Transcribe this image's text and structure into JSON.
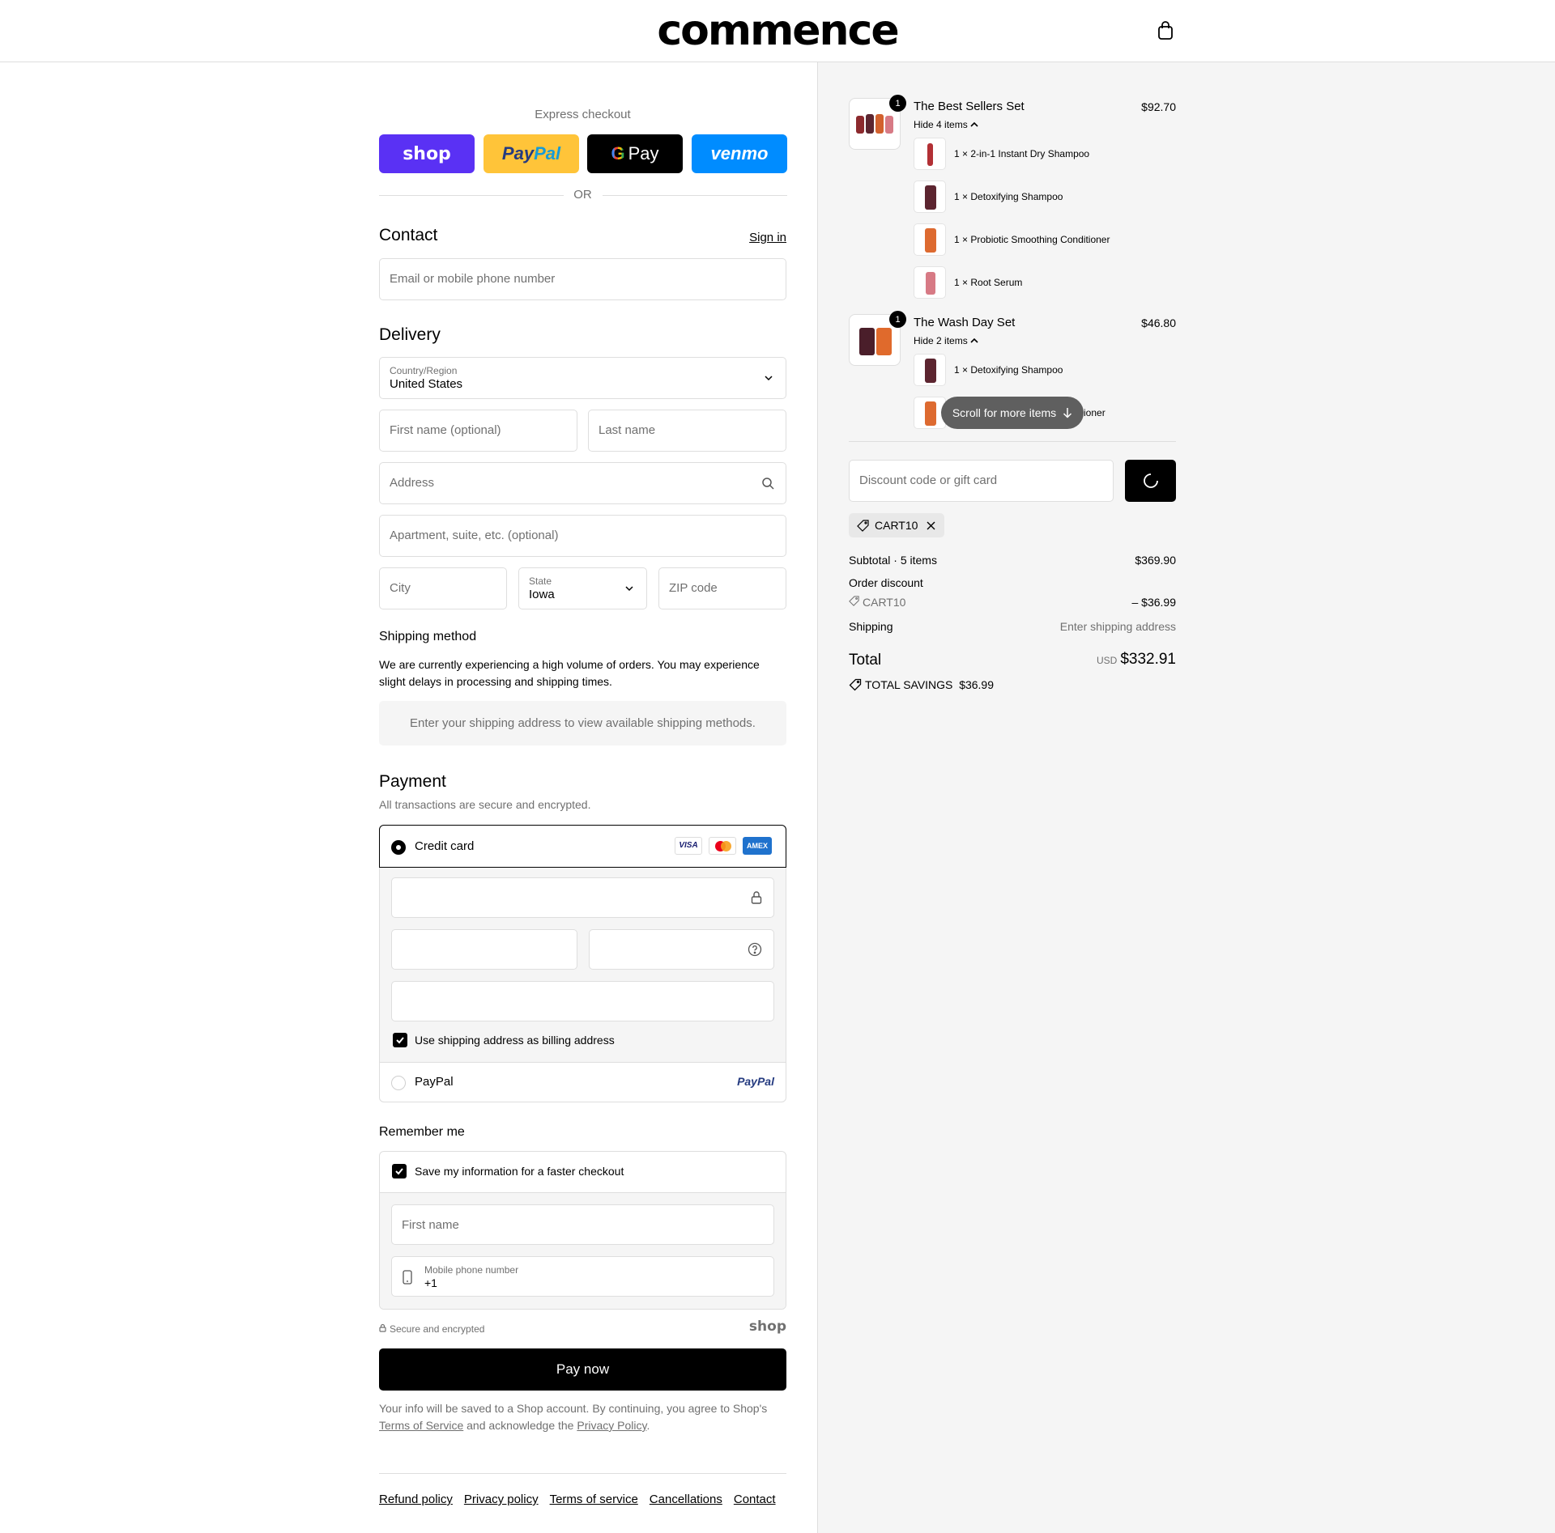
{
  "header": {
    "logo": "commence",
    "cart_icon": "bag-icon"
  },
  "express": {
    "title": "Express checkout",
    "buttons": {
      "shop": "shop",
      "paypal": "PayPal",
      "gpay": "Pay",
      "venmo": "venmo"
    },
    "or": "OR"
  },
  "contact": {
    "title": "Contact",
    "sign_in": "Sign in",
    "email_placeholder": "Email or mobile phone number"
  },
  "delivery": {
    "title": "Delivery",
    "country_label": "Country/Region",
    "country_value": "United States",
    "first_name_placeholder": "First name (optional)",
    "last_name_placeholder": "Last name",
    "address_placeholder": "Address",
    "apartment_placeholder": "Apartment, suite, etc. (optional)",
    "city_placeholder": "City",
    "state_label": "State",
    "state_value": "Iowa",
    "zip_placeholder": "ZIP code"
  },
  "shipping": {
    "title": "Shipping method",
    "notice": "We are currently experiencing a high volume of orders. You may experience slight delays in processing and shipping times.",
    "empty": "Enter your shipping address to view available shipping methods."
  },
  "payment": {
    "title": "Payment",
    "subtitle": "All transactions are secure and encrypted.",
    "credit_card": "Credit card",
    "cards": [
      "VISA",
      "Mastercard",
      "AMEX"
    ],
    "billing_checkbox": "Use shipping address as billing address",
    "paypal": "PayPal",
    "paypal_logo": "PayPal"
  },
  "remember": {
    "title": "Remember me",
    "save_checkbox": "Save my information for a faster checkout",
    "first_name_placeholder": "First name",
    "phone_label": "Mobile phone number",
    "phone_value": "+1",
    "secure": "Secure and encrypted",
    "shop_logo": "shop"
  },
  "pay_now": "Pay now",
  "legal": {
    "text_before": "Your info will be saved to a Shop account. By continuing, you agree to Shop's",
    "tos": "Terms of Service",
    "middle": "and acknowledge the",
    "privacy": "Privacy Policy",
    "end": "."
  },
  "footer_links": [
    "Refund policy",
    "Privacy policy",
    "Terms of service",
    "Cancellations",
    "Contact"
  ],
  "order": {
    "items": [
      {
        "qty": "1",
        "name": "The Best Sellers Set",
        "price": "$92.70",
        "toggle": "Hide 4 items",
        "sub": [
          {
            "qty": "1 ×",
            "name": "2-in-1 Instant Dry Shampoo"
          },
          {
            "qty": "1 ×",
            "name": "Detoxifying Shampoo"
          },
          {
            "qty": "1 ×",
            "name": "Probiotic Smoothing Conditioner"
          },
          {
            "qty": "1 ×",
            "name": "Root Serum"
          }
        ]
      },
      {
        "qty": "1",
        "name": "The Wash Day Set",
        "price": "$46.80",
        "toggle": "Hide 2 items",
        "sub": [
          {
            "qty": "1 ×",
            "name": "Detoxifying Shampoo"
          },
          {
            "qty": "",
            "name": "ioner"
          }
        ]
      }
    ],
    "scroll_pill": "Scroll for more items",
    "discount_placeholder": "Discount code or gift card",
    "applied_code": "CART10",
    "subtotal_label": "Subtotal · 5 items",
    "subtotal_value": "$369.90",
    "order_discount_label": "Order discount",
    "discount_code": "CART10",
    "discount_value": "– $36.99",
    "shipping_label": "Shipping",
    "shipping_value": "Enter shipping address",
    "total_label": "Total",
    "currency": "USD",
    "total_value": "$332.91",
    "savings_label": "TOTAL SAVINGS",
    "savings_value": "$36.99"
  },
  "colors": {
    "shop": "#5a31f4",
    "paypal": "#ffc439",
    "venmo": "#008cff",
    "text_muted": "#707070"
  }
}
